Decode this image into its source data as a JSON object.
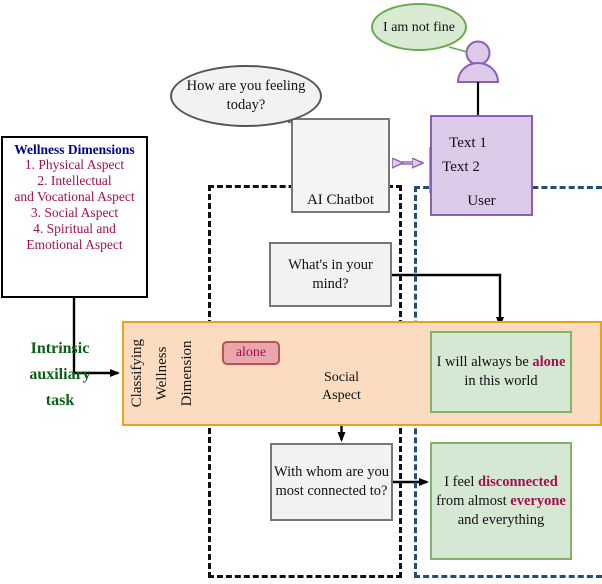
{
  "wellness_panel": {
    "title": "Wellness Dimensions",
    "items": [
      "1. Physical Aspect",
      "2.  Intellectual",
      "and Vocational Aspect",
      "3. Social Aspect",
      "4. Spiritual and",
      "Emotional Aspect"
    ]
  },
  "intrinsic": {
    "line1": "Intrinsic",
    "line2": "auxiliary",
    "line3": "task"
  },
  "band": {
    "label": "Classifying\nWellness\nDimension"
  },
  "chatbot": {
    "label": "AI Chatbot",
    "bubble": "How are you feeling today?"
  },
  "user": {
    "label": "User",
    "bubble": "I am not fine",
    "doc1": "Text 1",
    "doc2": "Text 2"
  },
  "questions": {
    "mind": "What's in your mind?",
    "connected": "With whom are you most connected to?"
  },
  "responses": {
    "alone": {
      "part1": "I will always be ",
      "highlight": "alone",
      "part2": " in this world"
    },
    "disconnected": {
      "part1": "I feel ",
      "highlight1": "disconnected",
      "part2": " from almost ",
      "highlight2": "everyone",
      "part3": " and everything"
    }
  },
  "tags": {
    "alone": "alone"
  },
  "decision": {
    "line1": "Social",
    "line2": "Aspect"
  },
  "colors": {
    "accent_orange": "#e8a317",
    "band_fill": "#fbdcc0",
    "green_fill": "#d5e8d4",
    "green_stroke": "#82b366",
    "purple_fill": "#ddc9e8",
    "purple_stroke": "#8b5fb5",
    "highlight_text": "#a50f4e",
    "title_blue": "#00008B",
    "intrinsic_green": "#0b5f18",
    "dashed_blue": "#1f4e79",
    "diamond_fill": "#cfe2f3",
    "diamond_stroke": "#6c8ebf",
    "doc_fill": "#ffe599",
    "doc_stroke": "#d6a62c"
  }
}
